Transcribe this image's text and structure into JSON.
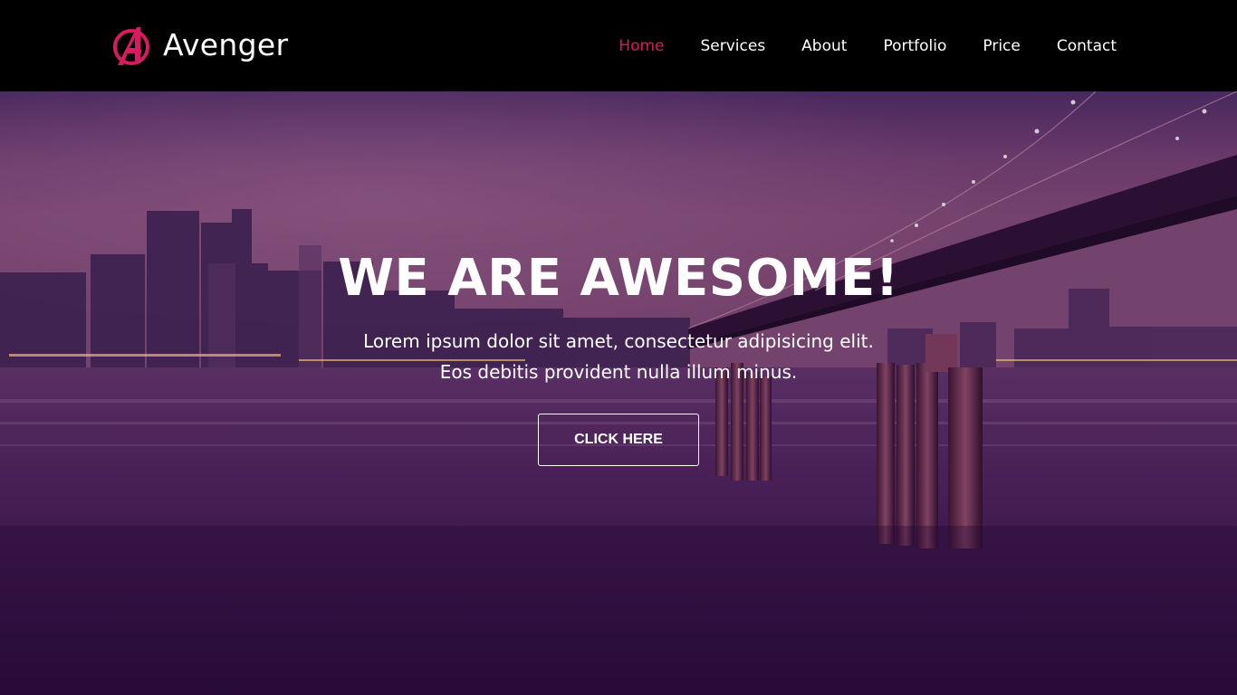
{
  "brand": {
    "name": "Avenger",
    "logo_icon": "avengers-a-icon",
    "logo_color": "#d81b60"
  },
  "nav": {
    "items": [
      {
        "label": "Home",
        "active": true
      },
      {
        "label": "Services",
        "active": false
      },
      {
        "label": "About",
        "active": false
      },
      {
        "label": "Portfolio",
        "active": false
      },
      {
        "label": "Price",
        "active": false
      },
      {
        "label": "Contact",
        "active": false
      }
    ],
    "active_color": "#d81b60",
    "text_color": "#ffffff",
    "background": "#000000"
  },
  "hero": {
    "title": "WE ARE AWESOME!",
    "text_line1": "Lorem ipsum dolor sit amet, consectetur adipisicing elit.",
    "text_line2": "Eos debitis provident nulla illum minus.",
    "button_label": "CLICK HERE",
    "overlay_color": "#4a1a55"
  }
}
